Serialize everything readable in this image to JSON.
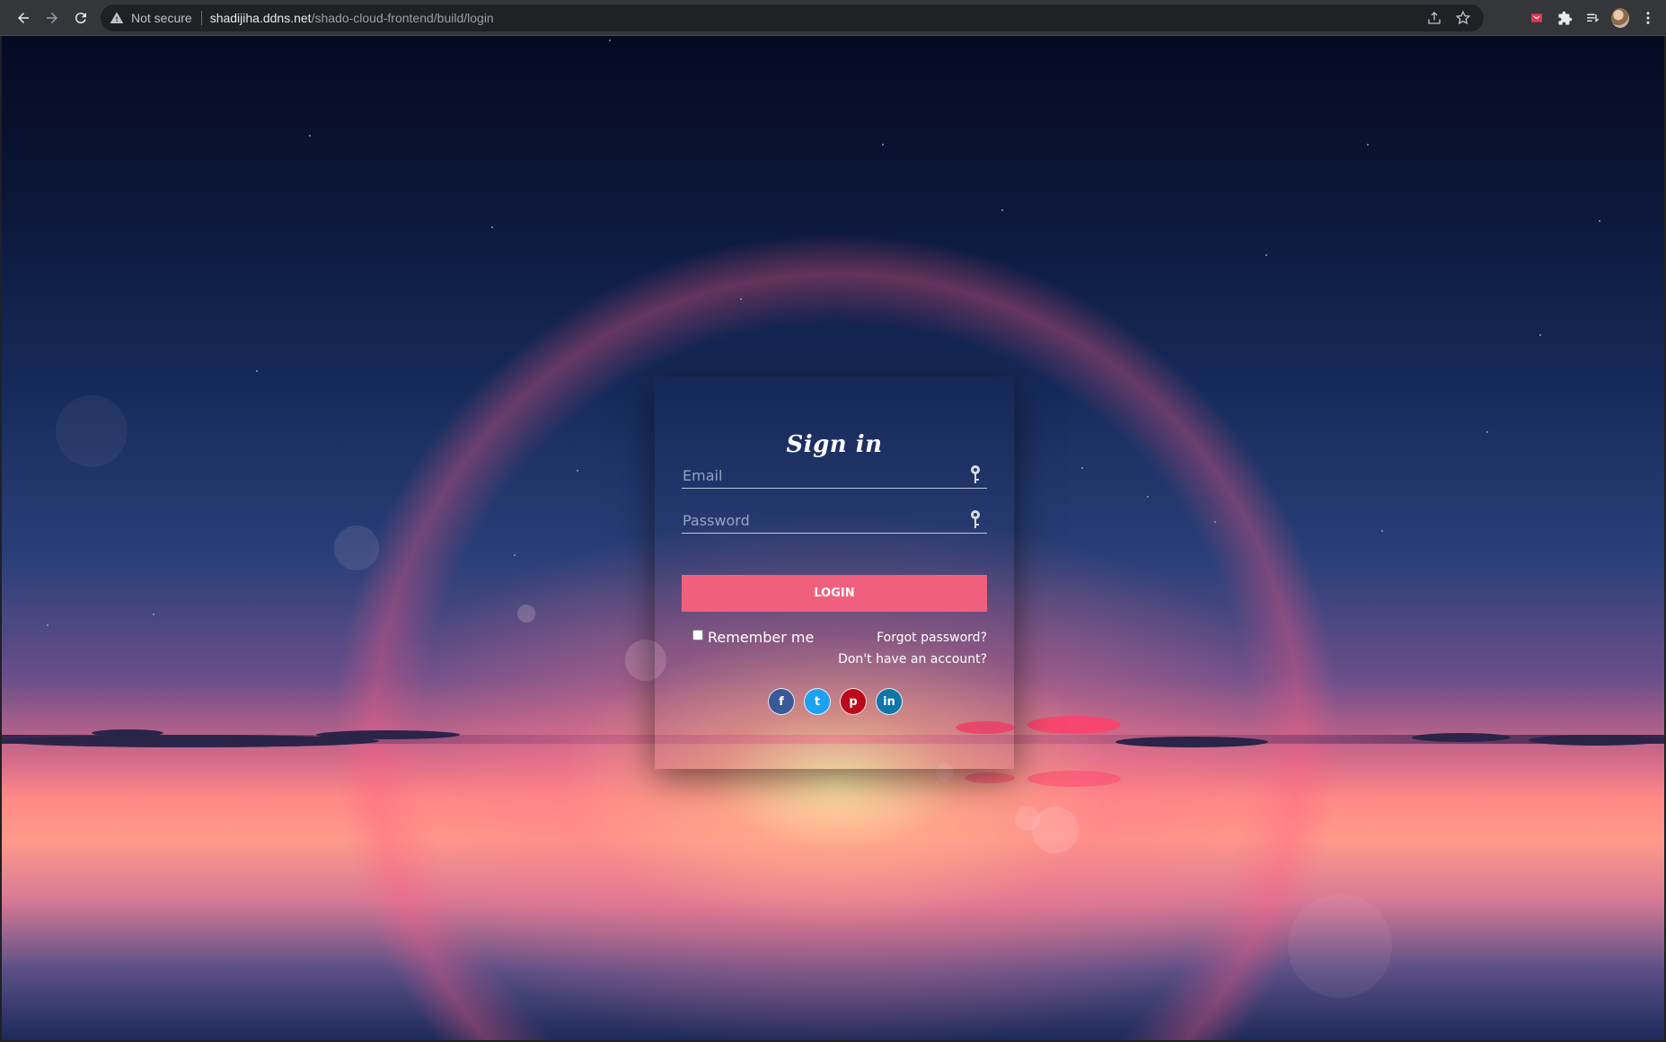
{
  "browser": {
    "security_label": "Not secure",
    "url_host": "shadijiha.ddns.net",
    "url_path": "/shado-cloud-frontend/build/login"
  },
  "login": {
    "title": "Sign in",
    "email_placeholder": "Email",
    "password_placeholder": "Password",
    "login_label": "LOGIN",
    "remember_label": "Remember me",
    "forgot_label": "Forgot password?",
    "signup_label": "Don't have an account?"
  },
  "socials": [
    {
      "label": "f",
      "icon": "facebook-icon",
      "color": "#3b5998"
    },
    {
      "label": "t",
      "icon": "twitter-icon",
      "color": "#1da1f2"
    },
    {
      "label": "p",
      "icon": "pinterest-icon",
      "color": "#bd081c"
    },
    {
      "label": "in",
      "icon": "linkedin-icon",
      "color": "#0e76a8"
    }
  ],
  "colors": {
    "accent": "#f0607e"
  }
}
